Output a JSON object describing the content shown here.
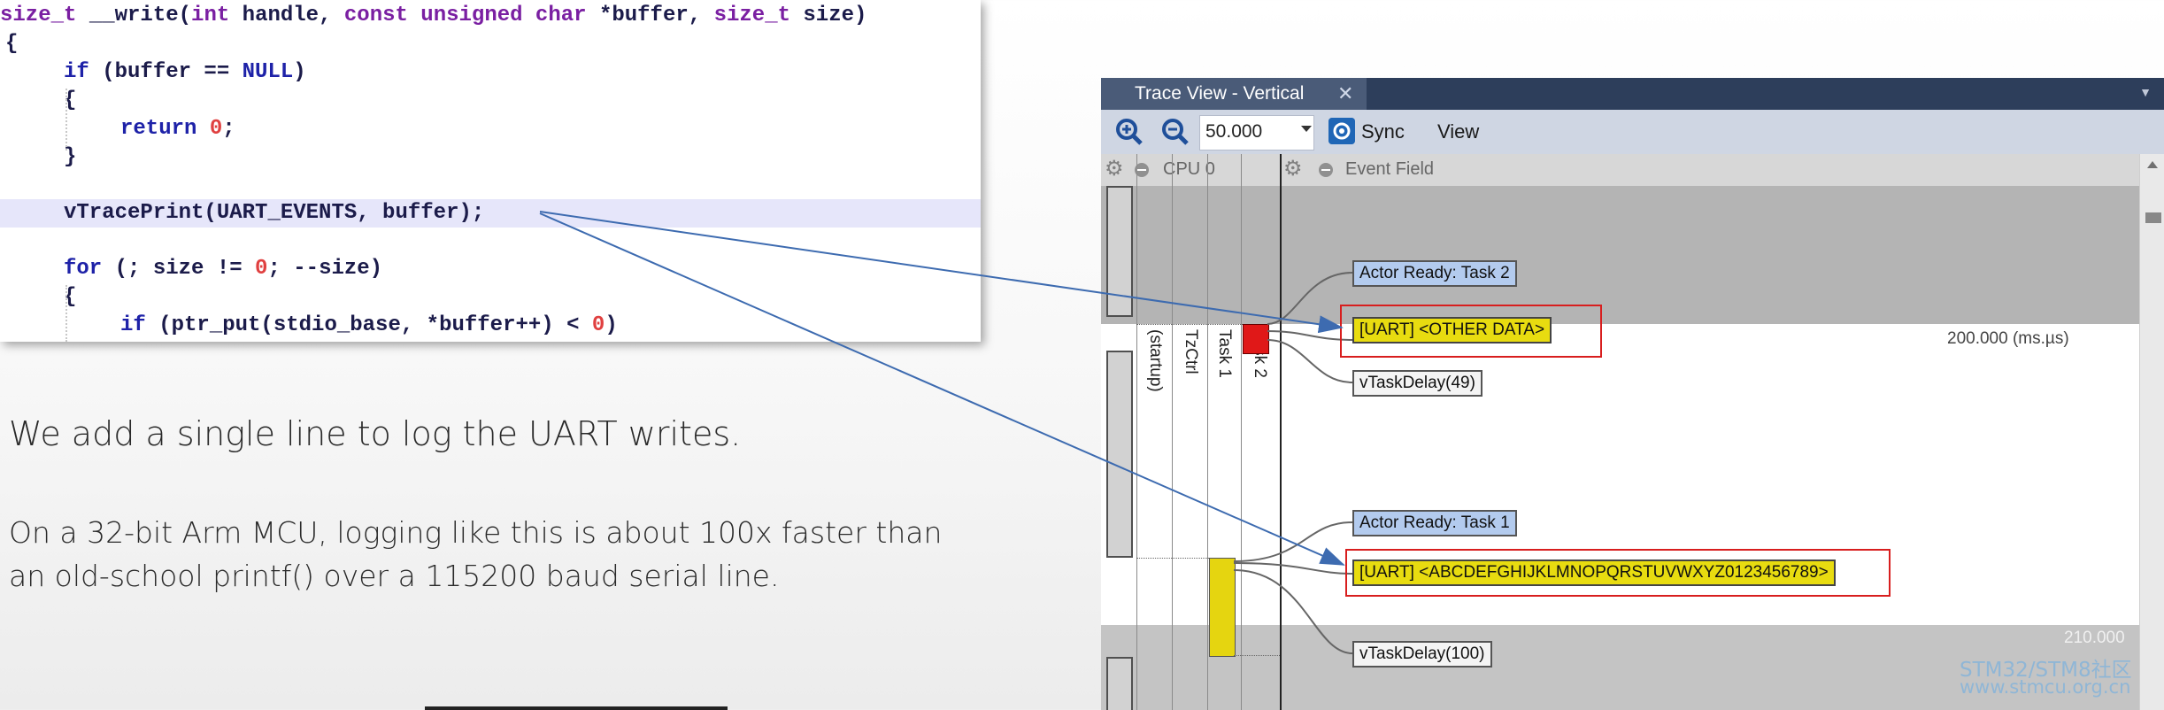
{
  "code": {
    "l1_type": "size_t",
    "l1_fn": " __write(",
    "l1_int": "int",
    "l1_handle": " handle, ",
    "l1_const": "const unsigned char",
    "l1_buf": " *buffer, ",
    "l1_size_t": "size_t",
    "l1_size": " size)",
    "brace_open": "{",
    "brace_close": "}",
    "if_kw": "if",
    "if_rest_a": " (buffer == ",
    "null_kw": "NULL",
    "if_rest_b": ")",
    "return_kw": "return",
    "return_num": "0",
    "return_semi": ";",
    "trace_call": "vTracePrint(UART_EVENTS, buffer);",
    "for_kw": "for",
    "for_rest_a": " (; size != ",
    "for_num": "0",
    "for_rest_b": "; --size)",
    "if2_rest_a": " (ptr_put(stdio_base, *buffer++) < ",
    "if2_num": "0",
    "if2_rest_b": ")"
  },
  "description": {
    "line1": "We add a single line to log the UART writes.",
    "line2": "On a 32-bit Arm MCU, logging like this is about 100x faster than an old-school printf() over a 115200 baud serial line."
  },
  "trace_view": {
    "title": "Trace View - Vertical",
    "close_glyph": "✕",
    "zoom_value": "50.000",
    "sync_label": "Sync",
    "view_label": "View",
    "cpu_header": "CPU 0",
    "event_header": "Event Field",
    "lanes": [
      "(startup)",
      "TzCtrl",
      "Task 1",
      "Task 2"
    ],
    "events": {
      "actor_ready_2": "Actor Ready: Task 2",
      "uart_other": "[UART] <OTHER DATA>",
      "delay_49": "vTaskDelay(49)",
      "actor_ready_1": "Actor Ready: Task 1",
      "uart_abc": "[UART]  <ABCDEFGHIJKLMNOPQRSTUVWXYZ0123456789>",
      "delay_100": "vTaskDelay(100)"
    },
    "time_200": "200.000 (ms.µs)",
    "time_210": "210.000",
    "colors": {
      "task1": "#e5d510",
      "task2": "#e01818",
      "highlight": "#d81e1e"
    }
  },
  "watermark": {
    "line1": "STM32/STM8社区",
    "line2": "www.stmcu.org.cn"
  }
}
